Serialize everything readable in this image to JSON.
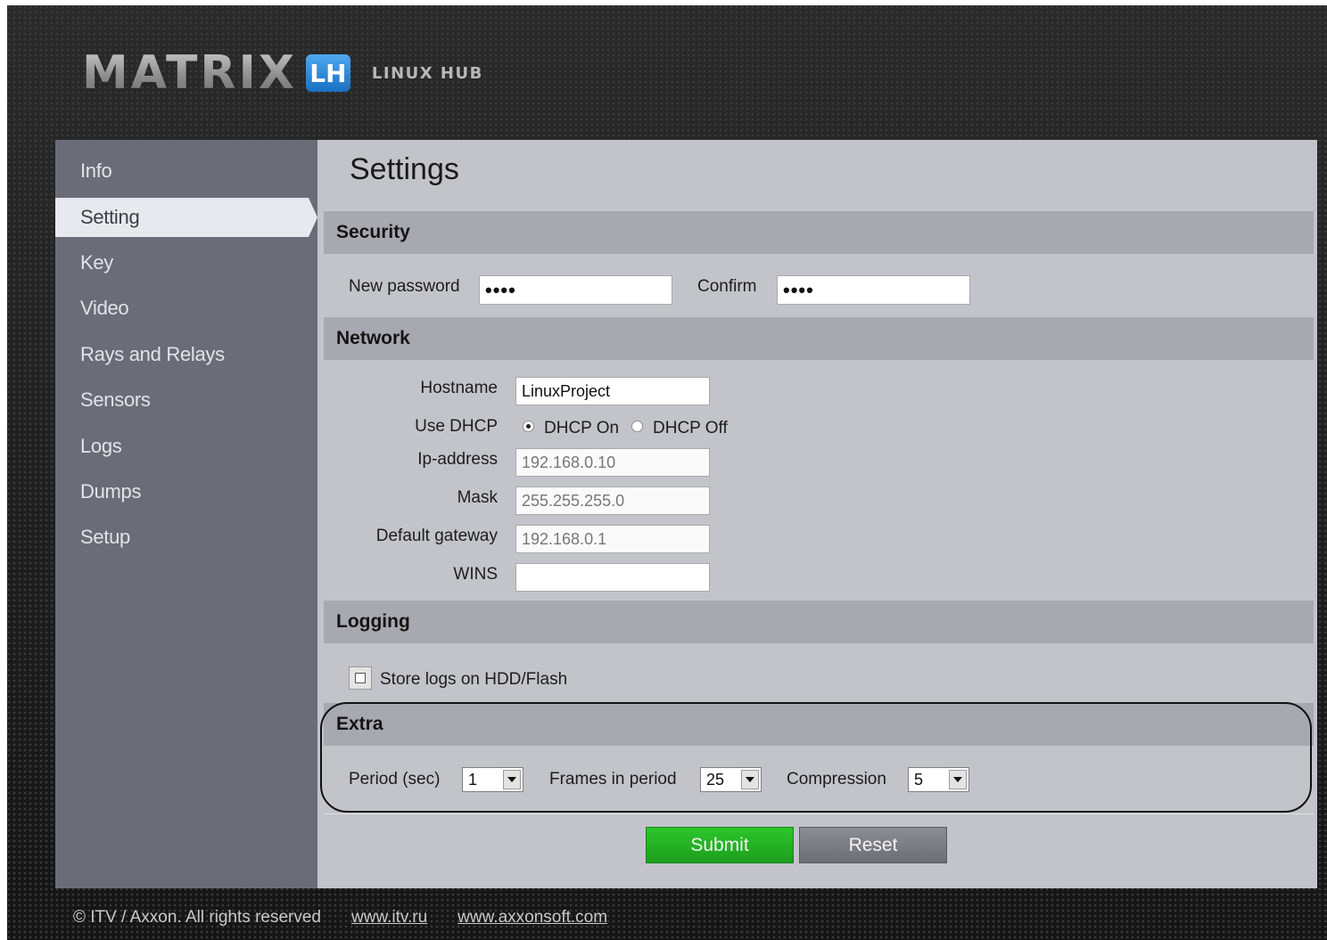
{
  "brand": {
    "logo_text": "MATRIX",
    "badge": "LH",
    "subtitle": "LINUX HUB"
  },
  "sidebar": {
    "items": [
      {
        "label": "Info",
        "active": false
      },
      {
        "label": "Setting",
        "active": true
      },
      {
        "label": "Key",
        "active": false
      },
      {
        "label": "Video",
        "active": false
      },
      {
        "label": "Rays and Relays",
        "active": false
      },
      {
        "label": "Sensors",
        "active": false
      },
      {
        "label": "Logs",
        "active": false
      },
      {
        "label": "Dumps",
        "active": false
      },
      {
        "label": "Setup",
        "active": false
      }
    ]
  },
  "main": {
    "title": "Settings",
    "security": {
      "header": "Security",
      "new_password_label": "New password",
      "new_password_value": "••••",
      "confirm_label": "Confirm",
      "confirm_value": "••••"
    },
    "network": {
      "header": "Network",
      "hostname_label": "Hostname",
      "hostname_value": "LinuxProject",
      "dhcp_label": "Use DHCP",
      "dhcp_on_label": "DHCP On",
      "dhcp_off_label": "DHCP Off",
      "dhcp_selected": "on",
      "ip_label": "Ip-address",
      "ip_value": "192.168.0.10",
      "mask_label": "Mask",
      "mask_value": "255.255.255.0",
      "gateway_label": "Default gateway",
      "gateway_value": "192.168.0.1",
      "wins_label": "WINS",
      "wins_value": ""
    },
    "logging": {
      "header": "Logging",
      "store_logs_label": "Store logs on HDD/Flash",
      "store_logs_checked": false
    },
    "extra": {
      "header": "Extra",
      "period_label": "Period (sec)",
      "period_value": "1",
      "frames_label": "Frames in period",
      "frames_value": "25",
      "compression_label": "Compression",
      "compression_value": "5"
    },
    "buttons": {
      "submit": "Submit",
      "reset": "Reset"
    }
  },
  "footer": {
    "copyright": "© ITV / Axxon. All rights reserved",
    "link1": "www.itv.ru",
    "link2": "www.axxonsoft.com"
  },
  "colors": {
    "accent_submit": "#22b422",
    "sidebar_bg": "#6a6d78",
    "content_bg": "#c3c4ca",
    "section_header_bg": "#a7a8b0"
  }
}
